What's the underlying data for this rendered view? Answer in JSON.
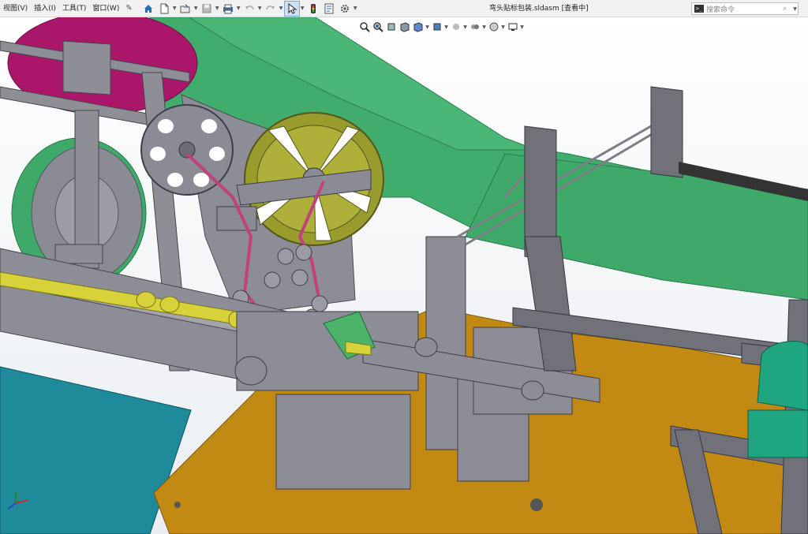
{
  "menu": [
    {
      "label": "视图(V)"
    },
    {
      "label": "插入(I)"
    },
    {
      "label": "工具(T)"
    },
    {
      "label": "窗口(W)"
    }
  ],
  "window": {
    "title": "弯头贴标包装.sldasm [查看中]"
  },
  "search": {
    "placeholder": "搜索命令"
  },
  "icons": {
    "pin": "pin-icon",
    "home": "home-icon",
    "new": "new-document-icon",
    "open": "open-folder-icon",
    "save": "save-icon",
    "print": "print-icon",
    "undo": "undo-icon",
    "redo": "redo-icon",
    "select": "select-arrow-icon",
    "rebuild": "traffic-light-icon",
    "file-props": "file-properties-icon",
    "options": "gear-icon"
  },
  "colors": {
    "toolbar_bg": "#f1f1f1",
    "machine_gray": "#8c8d97",
    "frame_dark": "#585860",
    "belt_green": "#3faa6b",
    "table_orange": "#c28a12",
    "teal": "#1f8a9a",
    "reel_magenta": "#b0186e",
    "reel_olive": "#9a9a2a",
    "cam_yellow": "#d8d23a"
  }
}
